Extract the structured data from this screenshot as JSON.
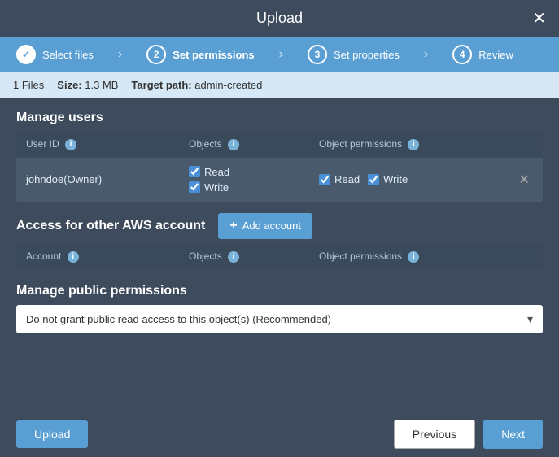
{
  "modal": {
    "title": "Upload",
    "close_label": "✕"
  },
  "steps": [
    {
      "id": 1,
      "label": "Select files",
      "status": "completed",
      "circle": "✓"
    },
    {
      "id": 2,
      "label": "Set permissions",
      "status": "active",
      "circle": "2"
    },
    {
      "id": 3,
      "label": "Set properties",
      "status": "inactive",
      "circle": "3"
    },
    {
      "id": 4,
      "label": "Review",
      "status": "inactive",
      "circle": "4"
    }
  ],
  "info_bar": {
    "files_label": "1 Files",
    "size_label": "Size:",
    "size_value": "1.3 MB",
    "target_label": "Target path:",
    "target_value": "admin-created"
  },
  "manage_users": {
    "section_title": "Manage users",
    "table_headers": {
      "user_id": "User ID",
      "objects": "Objects",
      "object_permissions": "Object permissions"
    },
    "rows": [
      {
        "user_id": "johndoe(Owner)",
        "objects": [
          "Read",
          "Write"
        ],
        "object_permissions": [
          "Read",
          "Write"
        ]
      }
    ]
  },
  "access_section": {
    "title": "Access for other AWS account",
    "add_button": "Add account",
    "table_headers": {
      "account": "Account",
      "objects": "Objects",
      "object_permissions": "Object permissions"
    }
  },
  "public_permissions": {
    "title": "Manage public permissions",
    "dropdown_value": "Do not grant public read access to this object(s) (Recommended)"
  },
  "footer": {
    "upload_label": "Upload",
    "previous_label": "Previous",
    "next_label": "Next"
  }
}
